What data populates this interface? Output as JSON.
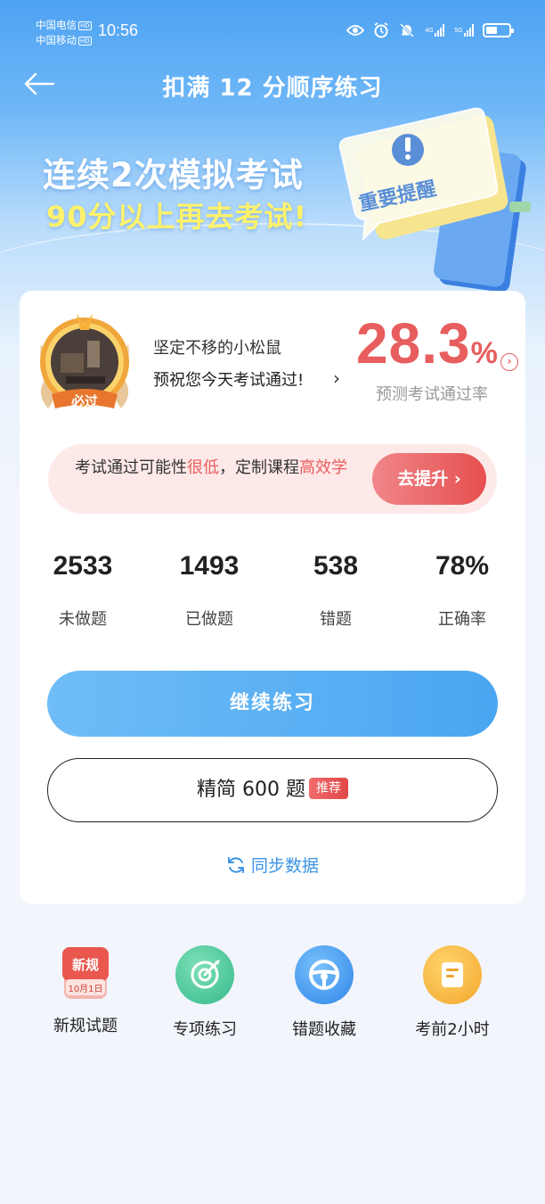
{
  "status_bar": {
    "carrier1": "中国电信",
    "carrier2": "中国移动",
    "hd": "HD",
    "time": "10:56",
    "net1": "4G",
    "net2": "5G"
  },
  "header": {
    "title": "扣满 12 分顺序练习"
  },
  "banner": {
    "line1": "连续2次模拟考试",
    "line2": "90分以上再去考试!",
    "badge_text": "重要提醒"
  },
  "profile": {
    "medal_text": "必过",
    "name": "坚定不移的小松鼠",
    "wish": "预祝您今天考试通过!"
  },
  "pass_rate": {
    "value": "28.3",
    "unit": "%",
    "label": "预测考试通过率"
  },
  "alert": {
    "text_a": "考试通过可能性",
    "text_b": "很低",
    "text_c": "，定制课程",
    "text_d": "高效学",
    "button": "去提升"
  },
  "stats": [
    {
      "value": "2533",
      "label": "未做题"
    },
    {
      "value": "1493",
      "label": "已做题"
    },
    {
      "value": "538",
      "label": "错题"
    },
    {
      "value": "78%",
      "label": "正确率"
    }
  ],
  "buttons": {
    "continue": "继续练习",
    "simplified": "精简 600 题",
    "recommend": "推荐",
    "sync": "同步数据"
  },
  "tools": [
    {
      "label": "新规试题",
      "icon": "new-rules-calendar-icon",
      "icon_top": "新规",
      "icon_date": "10月1日"
    },
    {
      "label": "专项练习",
      "icon": "target-icon"
    },
    {
      "label": "错题收藏",
      "icon": "steering-wheel-icon"
    },
    {
      "label": "考前2小时",
      "icon": "document-icon"
    }
  ],
  "colors": {
    "accent_red": "#e85d5d",
    "accent_blue": "#4aa6f1",
    "banner_yellow": "#fff26b"
  }
}
